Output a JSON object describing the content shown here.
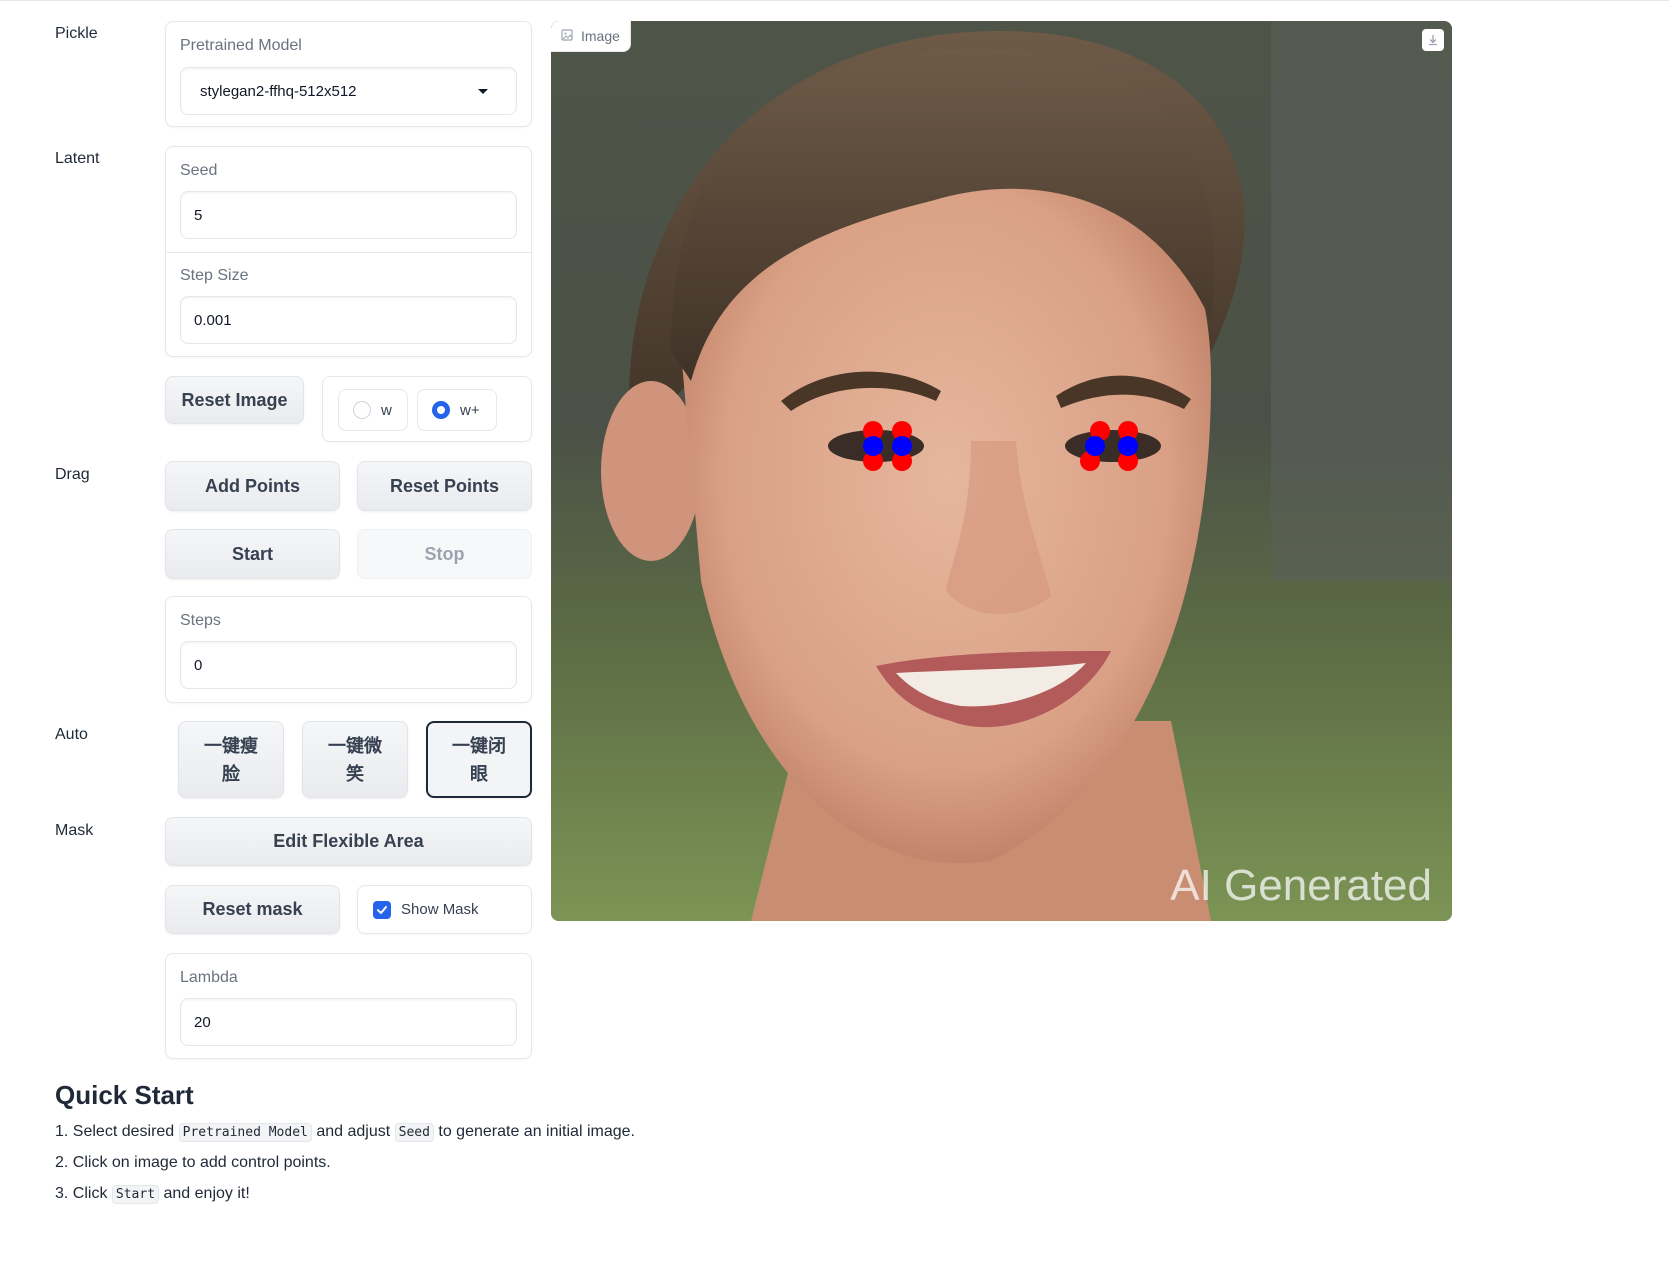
{
  "sections": {
    "pickle": "Pickle",
    "latent": "Latent",
    "drag": "Drag",
    "auto": "Auto",
    "mask": "Mask"
  },
  "pretrained_model": {
    "label": "Pretrained Model",
    "value": "stylegan2-ffhq-512x512"
  },
  "seed": {
    "label": "Seed",
    "value": "5"
  },
  "step_size": {
    "label": "Step Size",
    "value": "0.001"
  },
  "reset_image_label": "Reset Image",
  "latent_space": {
    "options": [
      "w",
      "w+"
    ],
    "selected": "w+"
  },
  "drag": {
    "add_points_label": "Add Points",
    "reset_points_label": "Reset Points",
    "start_label": "Start",
    "stop_label": "Stop",
    "steps_label": "Steps",
    "steps_value": "0"
  },
  "auto": {
    "buttons": [
      {
        "line1": "一键瘦",
        "line2": "脸"
      },
      {
        "line1": "一键微",
        "line2": "笑"
      },
      {
        "line1": "一键闭",
        "line2": "眼"
      }
    ],
    "selected_index": 2
  },
  "mask": {
    "edit_flexible_area_label": "Edit Flexible Area",
    "reset_mask_label": "Reset mask",
    "show_mask_label": "Show Mask",
    "show_mask_checked": true,
    "lambda_label": "Lambda",
    "lambda_value": "20"
  },
  "image": {
    "tag_label": "Image",
    "watermark": "AI Generated",
    "point_colors": {
      "handle": "#ff0000",
      "target": "#0000ff"
    }
  },
  "quick_start": {
    "title": "Quick Start",
    "step1": {
      "num": "1.",
      "pre": "Select desired",
      "code1": "Pretrained Model",
      "mid": "and adjust",
      "code2": "Seed",
      "post": "to generate an initial image."
    },
    "step2": {
      "text": "2. Click on image to add control points."
    },
    "step3": {
      "pre": "3. Click",
      "code": "Start",
      "post": "and enjoy it!"
    }
  },
  "colors": {
    "accent": "#2563eb",
    "border": "#e5e7eb",
    "label_gray": "#6b7280"
  }
}
